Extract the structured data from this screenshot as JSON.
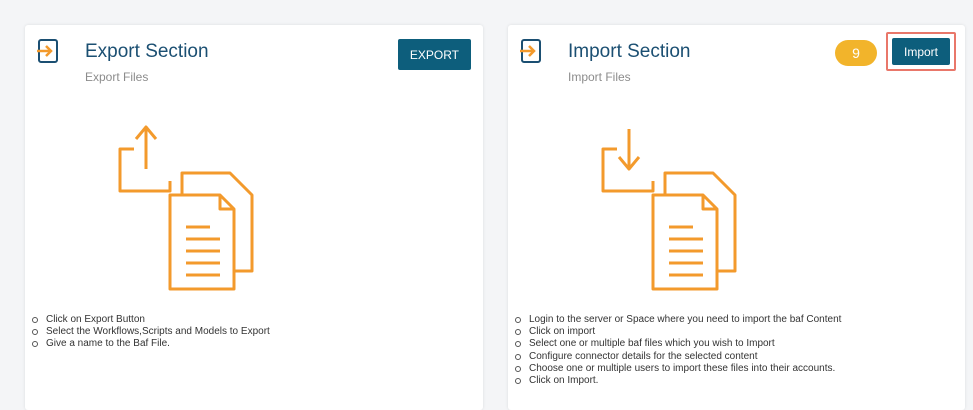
{
  "export_section": {
    "title": "Export Section",
    "subtitle": "Export Files",
    "button_label": "EXPORT",
    "icon": "export-icon",
    "illustration": "upload-documents-illustration",
    "steps": [
      "Click on Export Button",
      "Select the Workflows,Scripts and Models to Export",
      "Give a name to the Baf File."
    ]
  },
  "import_section": {
    "title": "Import Section",
    "subtitle": "Import Files",
    "button_label": "Import",
    "step_badge": "9",
    "icon": "import-icon",
    "illustration": "download-documents-illustration",
    "steps": [
      "Login to the server or Space where you need to import the baf Content",
      "Click on import",
      "Select one or multiple baf files which you wish to Import",
      "Configure connector details for the selected content",
      "Choose one or multiple users to import these files into their accounts.",
      "Click on Import."
    ]
  },
  "colors": {
    "accent_orange": "#f39a2c",
    "button_bg": "#0d5e7c",
    "title_blue": "#1b4f72",
    "highlight_border": "#e9776a",
    "badge_yellow": "#f2b42b"
  }
}
